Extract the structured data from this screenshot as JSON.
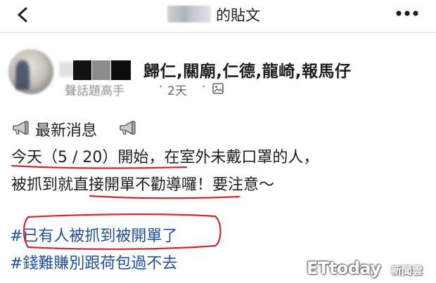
{
  "header": {
    "title": "的貼文",
    "back_icon": "chevron-left-icon",
    "more_icon": "more-horizontal-icon"
  },
  "post": {
    "groups": "歸仁,關廟,仁德,龍崎,報馬仔",
    "badge": "聲話題高手",
    "time": "2天",
    "audience_icon": "image-audience-icon",
    "body": {
      "heading": "最新消息",
      "line1": "今天（5 / 20）開始，在室外未戴口罩的人，",
      "line2": "被抓到就直接開單不勸導囉！要注意～"
    },
    "hashtags": [
      "#已有人被抓到被開單了",
      "#錢難賺別跟荷包過不去"
    ]
  },
  "watermark": {
    "brand": "ETtoday",
    "suffix": "新聞雲"
  },
  "colors": {
    "hashtag": "#1f4ea3",
    "annotation": "#d9262b",
    "text": "#1c1e21",
    "meta": "#65676b"
  }
}
